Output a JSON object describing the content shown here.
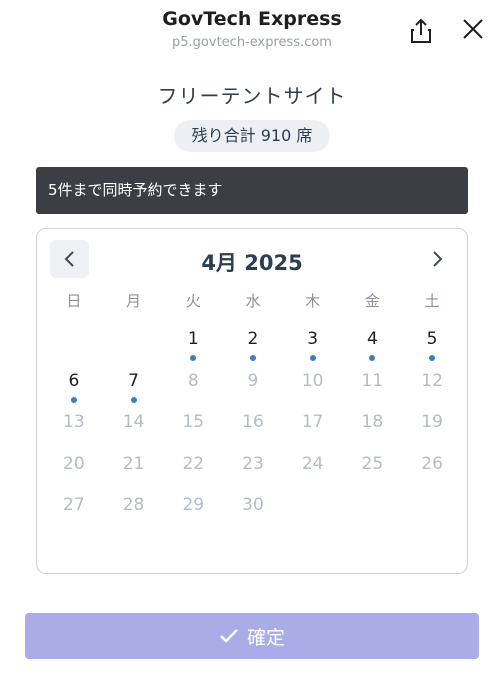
{
  "header": {
    "title": "GovTech Express",
    "url": "p5.govtech-express.com",
    "share_icon": "share-icon",
    "close_icon": "close-icon"
  },
  "event": {
    "title": "フリーテントサイト",
    "seats_remaining": "残り合計 910 席"
  },
  "notice": {
    "text": "5件まで同時予約できます"
  },
  "calendar": {
    "month_label": "4月 2025",
    "prev_icon": "chevron-left-icon",
    "next_icon": "chevron-right-icon",
    "weekdays": [
      "日",
      "月",
      "火",
      "水",
      "木",
      "金",
      "土"
    ],
    "leading_blanks": 2,
    "days": [
      {
        "n": "1",
        "available": true
      },
      {
        "n": "2",
        "available": true
      },
      {
        "n": "3",
        "available": true
      },
      {
        "n": "4",
        "available": true
      },
      {
        "n": "5",
        "available": true
      },
      {
        "n": "6",
        "available": true
      },
      {
        "n": "7",
        "available": true
      },
      {
        "n": "8",
        "available": false
      },
      {
        "n": "9",
        "available": false
      },
      {
        "n": "10",
        "available": false
      },
      {
        "n": "11",
        "available": false
      },
      {
        "n": "12",
        "available": false
      },
      {
        "n": "13",
        "available": false
      },
      {
        "n": "14",
        "available": false
      },
      {
        "n": "15",
        "available": false
      },
      {
        "n": "16",
        "available": false
      },
      {
        "n": "17",
        "available": false
      },
      {
        "n": "18",
        "available": false
      },
      {
        "n": "19",
        "available": false
      },
      {
        "n": "20",
        "available": false
      },
      {
        "n": "21",
        "available": false
      },
      {
        "n": "22",
        "available": false
      },
      {
        "n": "23",
        "available": false
      },
      {
        "n": "24",
        "available": false
      },
      {
        "n": "25",
        "available": false
      },
      {
        "n": "26",
        "available": false
      },
      {
        "n": "27",
        "available": false
      },
      {
        "n": "28",
        "available": false
      },
      {
        "n": "29",
        "available": false
      },
      {
        "n": "30",
        "available": false
      }
    ],
    "available_dot_color": "#3a7fc1",
    "unavailable_text_color": "#b5bcc4"
  },
  "footer": {
    "confirm_label": "確定",
    "confirm_icon": "check-icon",
    "confirm_color": "#a9ace6"
  }
}
